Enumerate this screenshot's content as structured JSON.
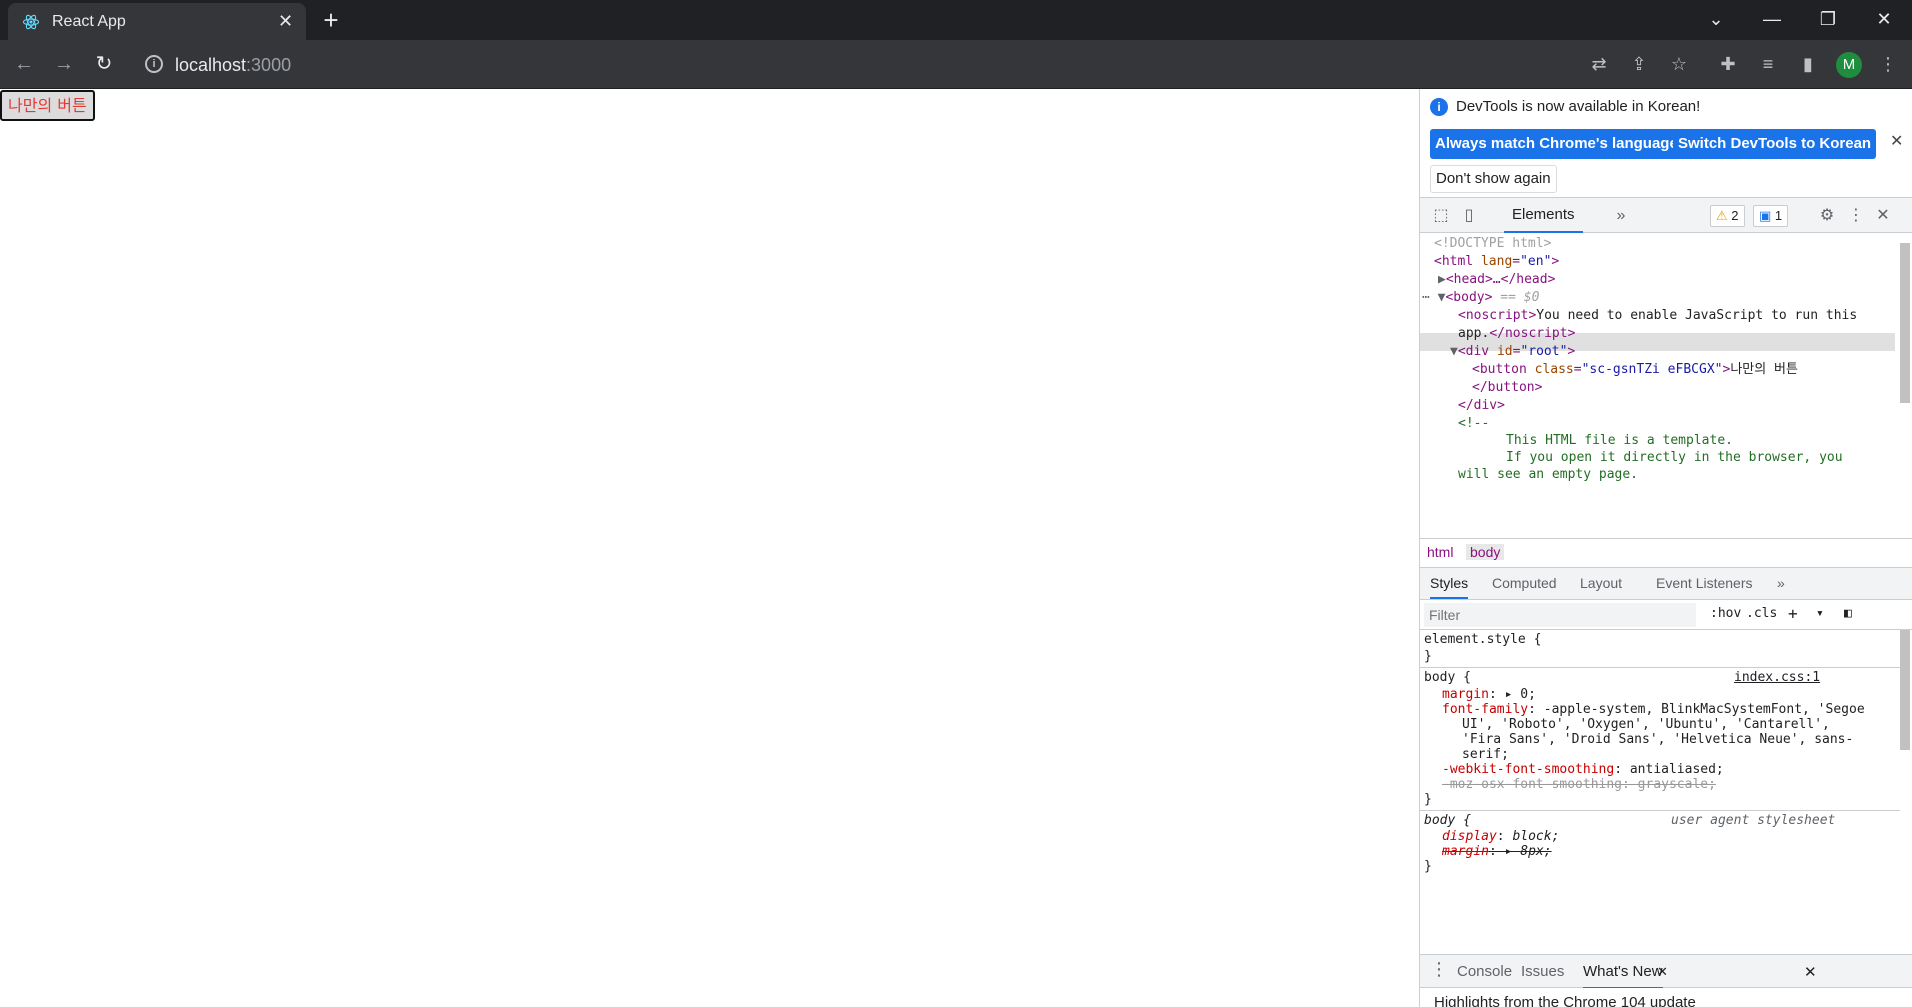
{
  "browser": {
    "tab_title": "React App",
    "url_host": "localhost",
    "url_port": ":3000"
  },
  "page": {
    "button_label": "나만의 버튼"
  },
  "devtools": {
    "infobar": {
      "message": "DevTools is now available in Korean!",
      "btn_match": "Always match Chrome's language",
      "btn_switch": "Switch DevTools to Korean",
      "btn_dont_show": "Don't show again"
    },
    "tabs": {
      "elements": "Elements",
      "warnings_count": "2",
      "messages_count": "1"
    },
    "dom": {
      "doctype": "<!DOCTYPE html>",
      "html_open": "<html",
      "html_attr": "lang",
      "html_val": "\"en\"",
      "head": "<head>…</head>",
      "body": "<body>",
      "body_marker": " == $0",
      "noscript_open": "<noscript>",
      "noscript_text": "You need to enable JavaScript to run this",
      "noscript_text2": "app.",
      "noscript_close": "</noscript>",
      "div_open": "<div",
      "div_attr": "id",
      "div_val": "\"root\"",
      "button_open": "<button",
      "button_attr": "class",
      "button_val": "\"sc-gsnTZi eFBCGX\"",
      "button_text": "나만의 버튼",
      "button_close": "</button>",
      "div_close": "</div>",
      "comment_open": "<!--",
      "comment_1": "This HTML file is a template.",
      "comment_2": "If you open it directly in the browser, you",
      "comment_3": "will see an empty page."
    },
    "breadcrumbs": [
      "html",
      "body"
    ],
    "styles_tabs": [
      "Styles",
      "Computed",
      "Layout",
      "Event Listeners"
    ],
    "filter_placeholder": "Filter",
    "filter_hov": ":hov",
    "filter_cls": ".cls",
    "rules": {
      "element_style": "element.style {",
      "close": "}",
      "body_sel": "body {",
      "body_src": "index.css:1",
      "margin_prop": "margin",
      "margin_val": "0;",
      "ff_prop": "font-family",
      "ff_val1": "-apple-system, BlinkMacSystemFont, 'Segoe",
      "ff_val2": "UI', 'Roboto', 'Oxygen', 'Ubuntu', 'Cantarell',",
      "ff_val3": "'Fira Sans', 'Droid Sans', 'Helvetica Neue', sans-",
      "ff_val4": "serif;",
      "wfs_prop": "-webkit-font-smoothing",
      "wfs_val": "antialiased;",
      "moz_line": "-moz-osx-font-smoothing: grayscale;",
      "ua_sel": "body {",
      "ua_src": "user agent stylesheet",
      "display_prop": "display",
      "display_val": "block;",
      "ua_margin_prop": "margin",
      "ua_margin_val": "8px;"
    },
    "drawer": {
      "tabs": [
        "Console",
        "Issues",
        "What's New"
      ],
      "content": "Highlights from the Chrome 104 update"
    }
  }
}
